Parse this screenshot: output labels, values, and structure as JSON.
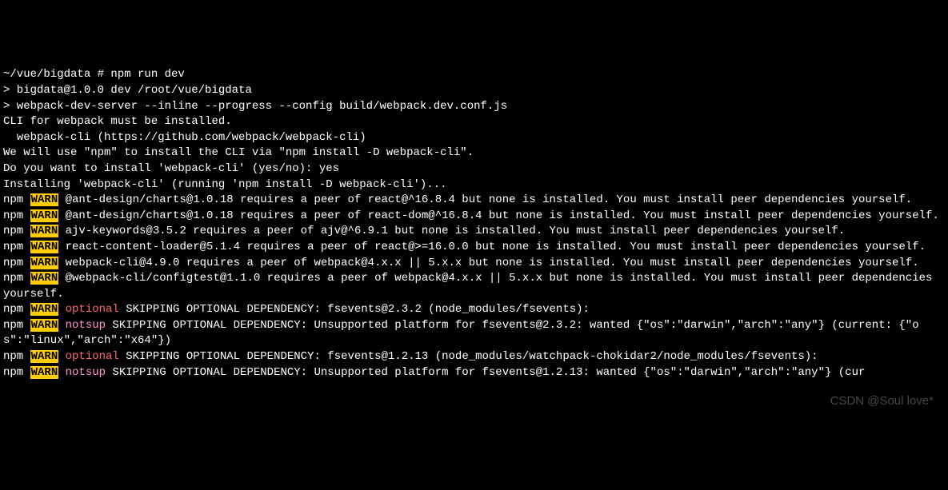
{
  "prompt": "~/vue/bigdata # npm run dev",
  "blank1": "",
  "line_dev": "> bigdata@1.0.0 dev /root/vue/bigdata",
  "line_server": "> webpack-dev-server --inline --progress --config build/webpack.dev.conf.js",
  "blank2": "",
  "line_cli1": "CLI for webpack must be installed.",
  "line_cli2": "  webpack-cli (https://github.com/webpack/webpack-cli)",
  "blank3": "",
  "line_use": "We will use \"npm\" to install the CLI via \"npm install -D webpack-cli\".",
  "line_prompt": "Do you want to install 'webpack-cli' (yes/no): yes",
  "line_installing": "Installing 'webpack-cli' (running 'npm install -D webpack-cli')...",
  "npm_prefix": "npm ",
  "warn_label": "WARN",
  "optional_label": " optional",
  "notsup_label": " notsup",
  "warn1": " @ant-design/charts@1.0.18 requires a peer of react@^16.8.4 but none is installed. You must install peer dependencies yourself.",
  "warn2": " @ant-design/charts@1.0.18 requires a peer of react-dom@^16.8.4 but none is installed. You must install peer dependencies yourself.",
  "warn3": " ajv-keywords@3.5.2 requires a peer of ajv@^6.9.1 but none is installed. You must install peer dependencies yourself.",
  "warn4": " react-content-loader@5.1.4 requires a peer of react@>=16.0.0 but none is installed. You must install peer dependencies yourself.",
  "warn5": " webpack-cli@4.9.0 requires a peer of webpack@4.x.x || 5.x.x but none is installed. You must install peer dependencies yourself.",
  "warn6": " @webpack-cli/configtest@1.1.0 requires a peer of webpack@4.x.x || 5.x.x but none is installed. You must install peer dependencies yourself.",
  "opt1": " SKIPPING OPTIONAL DEPENDENCY: fsevents@2.3.2 (node_modules/fsevents):",
  "notsup1": " SKIPPING OPTIONAL DEPENDENCY: Unsupported platform for fsevents@2.3.2: wanted {\"os\":\"darwin\",\"arch\":\"any\"} (current: {\"os\":\"linux\",\"arch\":\"x64\"})",
  "opt2": " SKIPPING OPTIONAL DEPENDENCY: fsevents@1.2.13 (node_modules/watchpack-chokidar2/node_modules/fsevents):",
  "notsup2": " SKIPPING OPTIONAL DEPENDENCY: Unsupported platform for fsevents@1.2.13: wanted {\"os\":\"darwin\",\"arch\":\"any\"} (cur",
  "watermark": "CSDN @Soul love*"
}
